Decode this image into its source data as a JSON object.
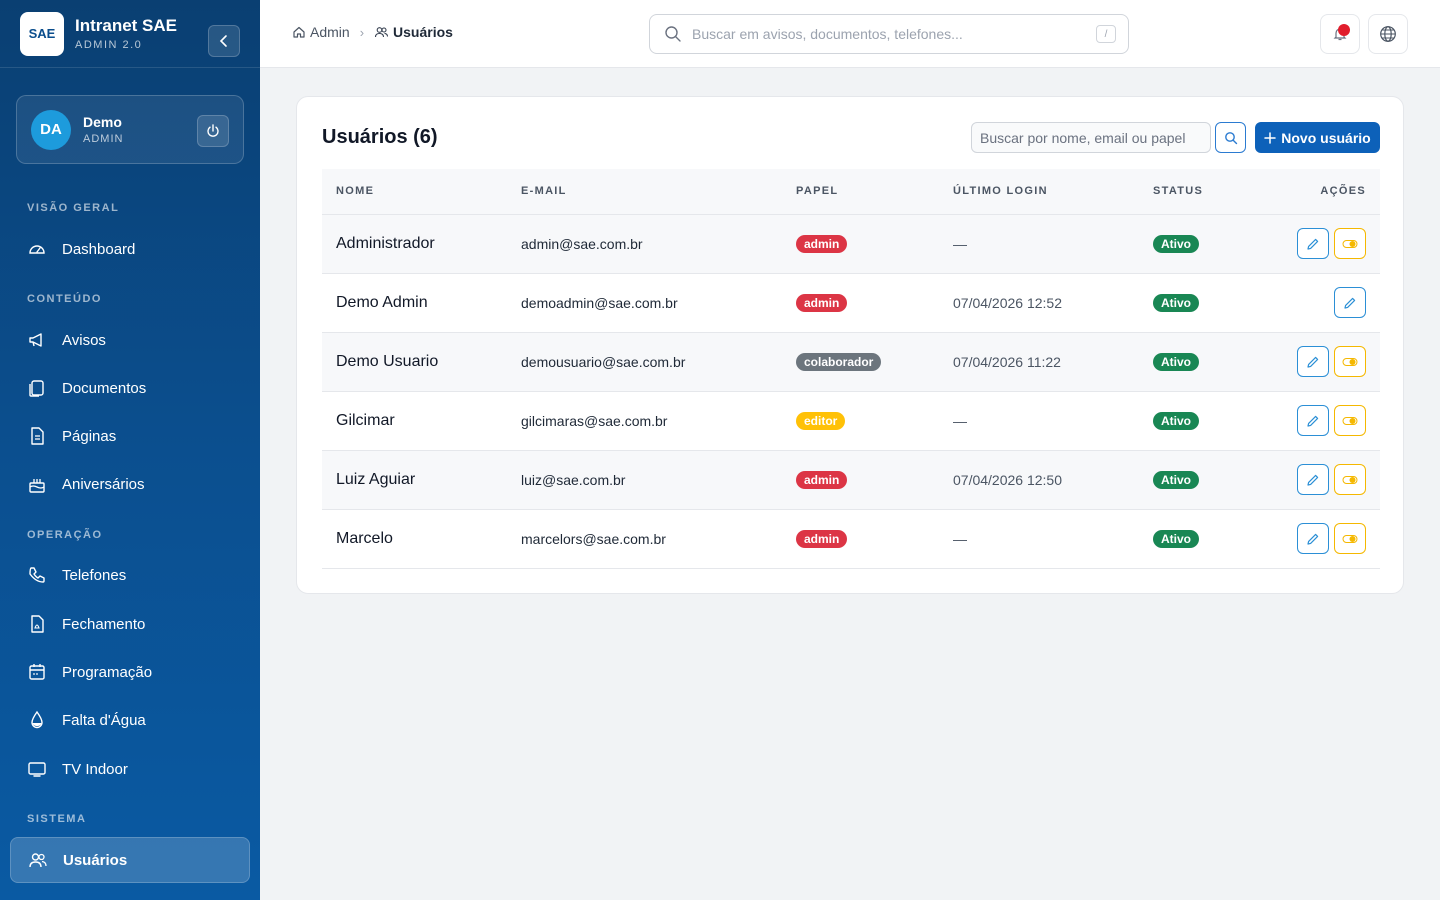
{
  "brand": {
    "logo_text": "SAE",
    "title": "Intranet SAE",
    "subtitle": "ADMIN 2.0"
  },
  "user": {
    "initials": "DA",
    "name": "Demo",
    "role": "ADMIN"
  },
  "sidebar": {
    "sections": [
      {
        "label": "VISÃO GERAL"
      },
      {
        "label": "CONTEÚDO"
      },
      {
        "label": "OPERAÇÃO"
      },
      {
        "label": "SISTEMA"
      }
    ],
    "items": [
      {
        "label": "Dashboard",
        "icon": "gauge-icon"
      },
      {
        "label": "Avisos",
        "icon": "megaphone-icon"
      },
      {
        "label": "Documentos",
        "icon": "documents-icon"
      },
      {
        "label": "Páginas",
        "icon": "page-icon"
      },
      {
        "label": "Aniversários",
        "icon": "cake-icon"
      },
      {
        "label": "Telefones",
        "icon": "phone-icon"
      },
      {
        "label": "Fechamento",
        "icon": "pdf-file-icon"
      },
      {
        "label": "Programação",
        "icon": "calendar-icon"
      },
      {
        "label": "Falta d'Água",
        "icon": "droplet-icon"
      },
      {
        "label": "TV Indoor",
        "icon": "tv-icon"
      },
      {
        "label": "Usuários",
        "icon": "users-icon",
        "active": true
      }
    ]
  },
  "header": {
    "breadcrumb": {
      "root": "Admin",
      "current": "Usuários"
    },
    "search_placeholder": "Buscar em avisos, documentos, telefones...",
    "search_shortcut": "/"
  },
  "main": {
    "title": "Usuários (6)",
    "search_placeholder": "Buscar por nome, email ou papel",
    "new_button": "Novo usuário",
    "columns": [
      "NOME",
      "E-MAIL",
      "PAPEL",
      "ÚLTIMO LOGIN",
      "STATUS",
      "AÇÕES"
    ],
    "rows": [
      {
        "name": "Administrador",
        "email": "admin@sae.com.br",
        "role": "admin",
        "last_login": "—",
        "status": "Ativo",
        "toggle": true
      },
      {
        "name": "Demo Admin",
        "email": "demoadmin@sae.com.br",
        "role": "admin",
        "last_login": "07/04/2026 12:52",
        "status": "Ativo",
        "toggle": false
      },
      {
        "name": "Demo Usuario",
        "email": "demousuario@sae.com.br",
        "role": "colaborador",
        "last_login": "07/04/2026 11:22",
        "status": "Ativo",
        "toggle": true
      },
      {
        "name": "Gilcimar",
        "email": "gilcimaras@sae.com.br",
        "role": "editor",
        "last_login": "—",
        "status": "Ativo",
        "toggle": true
      },
      {
        "name": "Luiz Aguiar",
        "email": "luiz@sae.com.br",
        "role": "admin",
        "last_login": "07/04/2026 12:50",
        "status": "Ativo",
        "toggle": true
      },
      {
        "name": "Marcelo",
        "email": "marcelors@sae.com.br",
        "role": "admin",
        "last_login": "—",
        "status": "Ativo",
        "toggle": true
      }
    ]
  },
  "colors": {
    "sidebar": "#0b4f8f",
    "primary": "#0d61b9",
    "admin": "#dc3545",
    "colaborador": "#6c757d",
    "editor": "#ffc107",
    "ativo": "#198754"
  }
}
